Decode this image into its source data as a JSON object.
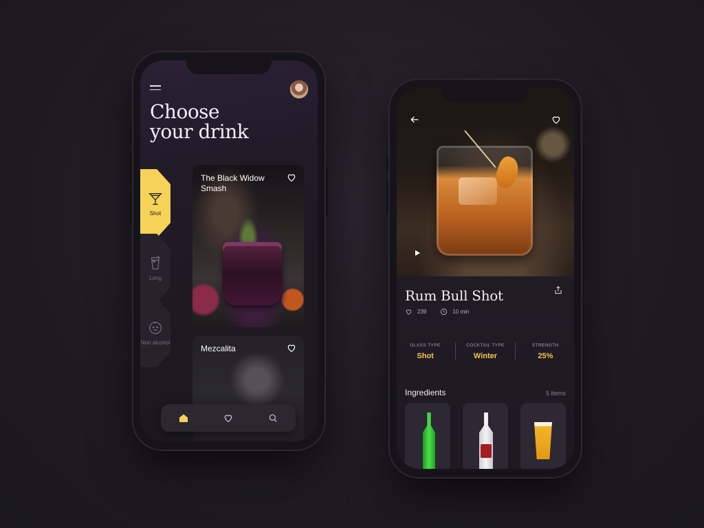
{
  "left_screen": {
    "title_line1": "Choose",
    "title_line2": "your drink",
    "categories": [
      {
        "label": "Shot",
        "icon": "martini-glass-icon",
        "active": true
      },
      {
        "label": "Long",
        "icon": "long-drink-icon",
        "active": false
      },
      {
        "label": "Non alcohol",
        "icon": "baby-face-icon",
        "active": false
      }
    ],
    "cards": [
      {
        "name": "The Black Widow Smash"
      },
      {
        "name": "Mezcalita"
      }
    ],
    "bottom_nav": [
      "home-icon",
      "heart-icon",
      "search-icon"
    ]
  },
  "right_screen": {
    "drink_name": "Rum Bull Shot",
    "likes": "239",
    "time": "10 min",
    "stats": [
      {
        "label": "GLASS TYPE",
        "value": "Shot"
      },
      {
        "label": "COCKTAIL TYPE",
        "value": "Winter"
      },
      {
        "label": "STRENGTH",
        "value": "25%"
      }
    ],
    "ingredients_title": "Ingredients",
    "ingredients_count": "5 items"
  },
  "colors": {
    "accent": "#f5d258",
    "stat_value": "#f2c94c",
    "background": "#1f1b24"
  }
}
